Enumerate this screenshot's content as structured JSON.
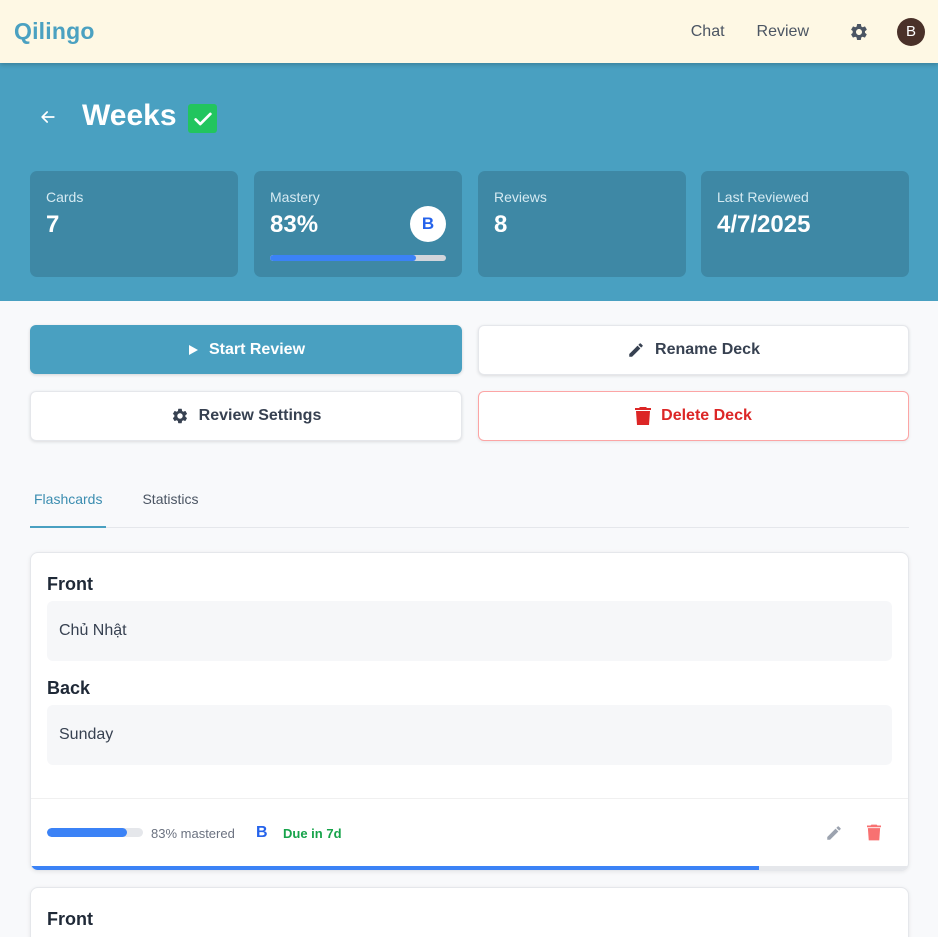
{
  "nav": {
    "brand": "Qilingo",
    "chat": "Chat",
    "review": "Review",
    "avatar_initial": "B"
  },
  "deck": {
    "title": "Weeks",
    "completed": true
  },
  "stats": {
    "cards": {
      "label": "Cards",
      "value": "7"
    },
    "mastery": {
      "label": "Mastery",
      "value": "83%",
      "level": "B",
      "progress_percent": 83
    },
    "reviews": {
      "label": "Reviews",
      "value": "8"
    },
    "last_reviewed": {
      "label": "Last Reviewed",
      "value": "4/7/2025"
    }
  },
  "actions": {
    "start_review": "Start Review",
    "rename_deck": "Rename Deck",
    "review_settings": "Review Settings",
    "delete_deck": "Delete Deck"
  },
  "tabs": [
    {
      "label": "Flashcards",
      "active": true
    },
    {
      "label": "Statistics",
      "active": false
    }
  ],
  "flashcards": [
    {
      "front_label": "Front",
      "front": "Chủ Nhật",
      "back_label": "Back",
      "back": "Sunday",
      "mastery_percent": 83,
      "mastered_text": "83% mastered",
      "level": "B",
      "due": "Due in 7d"
    },
    {
      "front_label": "Front"
    }
  ],
  "colors": {
    "brand": "#4ba1c1",
    "hero": "#49a0c1",
    "accent_blue": "#3b82f6",
    "success": "#22c55e",
    "danger": "#dc2626"
  }
}
